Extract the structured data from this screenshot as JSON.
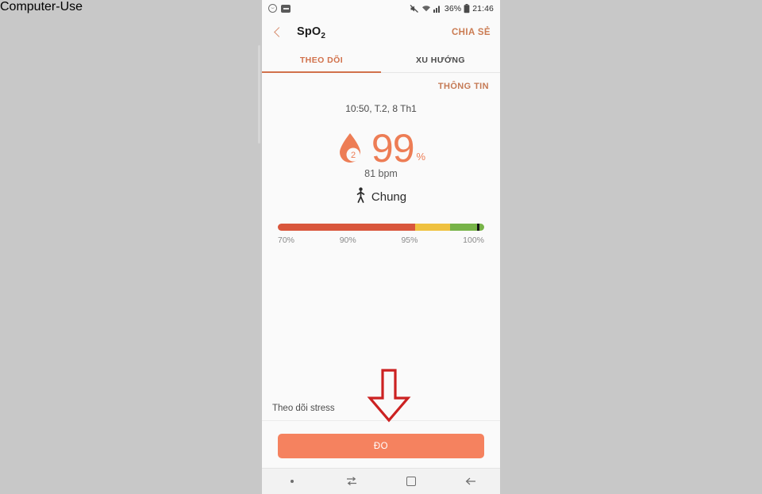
{
  "status_bar": {
    "icons_left": [
      "message-icon",
      "app-notification-icon"
    ],
    "mute_icon": "mute-icon",
    "wifi_icon": "wifi-icon",
    "signal_icon": "signal-bars-icon",
    "battery_percent": "36%",
    "battery_icon": "battery-icon",
    "clock": "21:46"
  },
  "app_bar": {
    "back_icon": "back-chevron-icon",
    "title": "SpO",
    "title_sub": "2",
    "share_label": "CHIA SẺ"
  },
  "tabs": [
    {
      "label": "THEO DÕI",
      "active": true
    },
    {
      "label": "XU HƯỚNG",
      "active": false
    }
  ],
  "content": {
    "info_link": "THÔNG TIN",
    "timestamp": "10:50, T.2, 8 Th1",
    "drop_icon": "blood-drop-o2-icon",
    "drop_badge": "2",
    "value": "99",
    "unit": "%",
    "bpm": "81 bpm",
    "state_icon": "walking-person-icon",
    "state_label": "Chung",
    "scale": {
      "ticks": [
        "70%",
        "90%",
        "95%",
        "100%"
      ],
      "marker_percent": 99,
      "segments": [
        {
          "name": "low",
          "color": "#d9563c",
          "from": 70,
          "to": 90
        },
        {
          "name": "medium",
          "color": "#efc13f",
          "from": 90,
          "to": 95
        },
        {
          "name": "normal",
          "color": "#77b348",
          "from": 95,
          "to": 100
        }
      ]
    },
    "stress_label": "Theo dõi stress",
    "measure_button": "ĐO"
  },
  "nav_bar": {
    "items": [
      "nav-dot",
      "recents-icon",
      "home-icon",
      "back-icon"
    ]
  },
  "annotation": {
    "arrow_icon": "red-down-arrow-annotation",
    "color": "#cc2222"
  },
  "colors": {
    "accent": "#ed7d55",
    "button": "#f5825f",
    "tab_active": "#d1714b",
    "page_bg": "#c8c8c8",
    "screen_bg": "#fafafa"
  }
}
